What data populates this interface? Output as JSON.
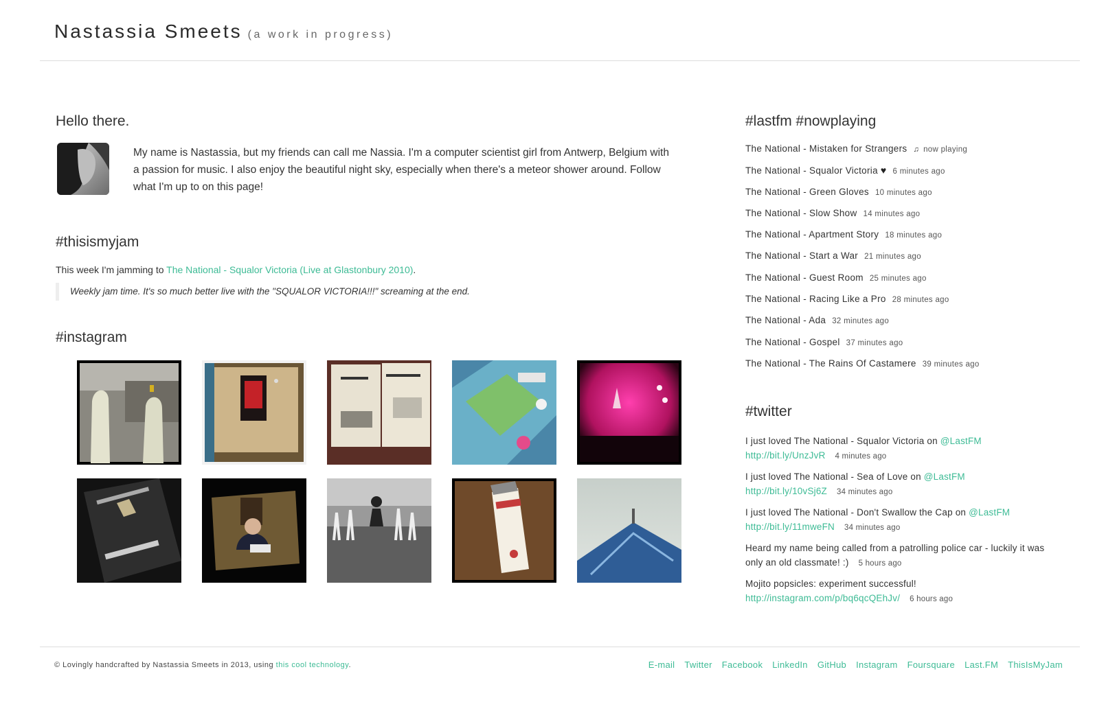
{
  "header": {
    "title": "Nastassia Smeets",
    "subtitle": "(a work in progress)"
  },
  "intro": {
    "heading": "Hello there.",
    "text": "My name is Nastassia, but my friends can call me Nassia. I'm a computer scientist girl from Antwerp, Belgium with a passion for music. I also enjoy the beautiful night sky, especially when there's a meteor shower around. Follow what I'm up to on this page!"
  },
  "jam": {
    "heading": "#thisismyjam",
    "prefix": "This week I'm jamming to ",
    "link": "The National - Squalor Victoria (Live at Glastonbury 2010)",
    "suffix": ".",
    "quote": "Weekly jam time. It's so much better live with the \"SQUALOR VICTORIA!!!\" screaming at the end."
  },
  "instagram": {
    "heading": "#instagram",
    "photos": [
      {
        "icon": "photo-popsicles"
      },
      {
        "icon": "photo-poster-wall"
      },
      {
        "icon": "photo-atari-manual"
      },
      {
        "icon": "photo-board-game"
      },
      {
        "icon": "photo-concert-stage"
      },
      {
        "icon": "photo-book-clash-of-kings"
      },
      {
        "icon": "photo-tv-screen"
      },
      {
        "icon": "photo-fountain"
      },
      {
        "icon": "photo-eye-cream-tube"
      },
      {
        "icon": "photo-blue-building"
      }
    ]
  },
  "lastfm": {
    "heading": "#lastfm #nowplaying",
    "tracks": [
      {
        "title": "The National - Mistaken for Strangers",
        "time": "now playing"
      },
      {
        "title": "The National - Squalor Victoria",
        "time": "6 minutes ago"
      },
      {
        "title": "The National - Green Gloves",
        "time": "10 minutes ago"
      },
      {
        "title": "The National - Slow Show",
        "time": "14 minutes ago"
      },
      {
        "title": "The National - Apartment Story",
        "time": "18 minutes ago"
      },
      {
        "title": "The National - Start a War",
        "time": "21 minutes ago"
      },
      {
        "title": "The National - Guest Room",
        "time": "25 minutes ago"
      },
      {
        "title": "The National - Racing Like a Pro",
        "time": "28 minutes ago"
      },
      {
        "title": "The National - Ada",
        "time": "32 minutes ago"
      },
      {
        "title": "The National - Gospel",
        "time": "37 minutes ago"
      },
      {
        "title": "The National - The Rains Of Castamere",
        "time": "39 minutes ago"
      }
    ]
  },
  "twitter": {
    "heading": "#twitter",
    "tweets": [
      {
        "text": "I just loved The National - Squalor Victoria on ",
        "mention": "@LastFM",
        "link": "http://bit.ly/UnzJvR",
        "time": "4 minutes ago"
      },
      {
        "text": "I just loved The National - Sea of Love on ",
        "mention": "@LastFM",
        "link": "http://bit.ly/10vSj6Z",
        "time": "34 minutes ago"
      },
      {
        "text": "I just loved The National - Don't Swallow the Cap on ",
        "mention": "@LastFM",
        "link": "http://bit.ly/11mweFN",
        "time": "34 minutes ago"
      },
      {
        "text": "Heard my name being called from a patrolling police car - luckily it was only an old classmate! :)",
        "time": "5 hours ago"
      },
      {
        "text": "Mojito popsicles: experiment successful! ",
        "link": "http://instagram.com/p/bq6qcQEhJv/",
        "time": "6 hours ago"
      }
    ]
  },
  "footer": {
    "credit_prefix": "© Lovingly handcrafted by Nastassia Smeets in 2013, using ",
    "credit_link": "this cool technology",
    "credit_suffix": ".",
    "links": [
      "E-mail",
      "Twitter",
      "Facebook",
      "LinkedIn",
      "GitHub",
      "Instagram",
      "Foursquare",
      "Last.FM",
      "ThisIsMyJam"
    ]
  },
  "colors": {
    "accent": "#3dbb95",
    "text": "#333333",
    "rule": "#dddddd"
  }
}
